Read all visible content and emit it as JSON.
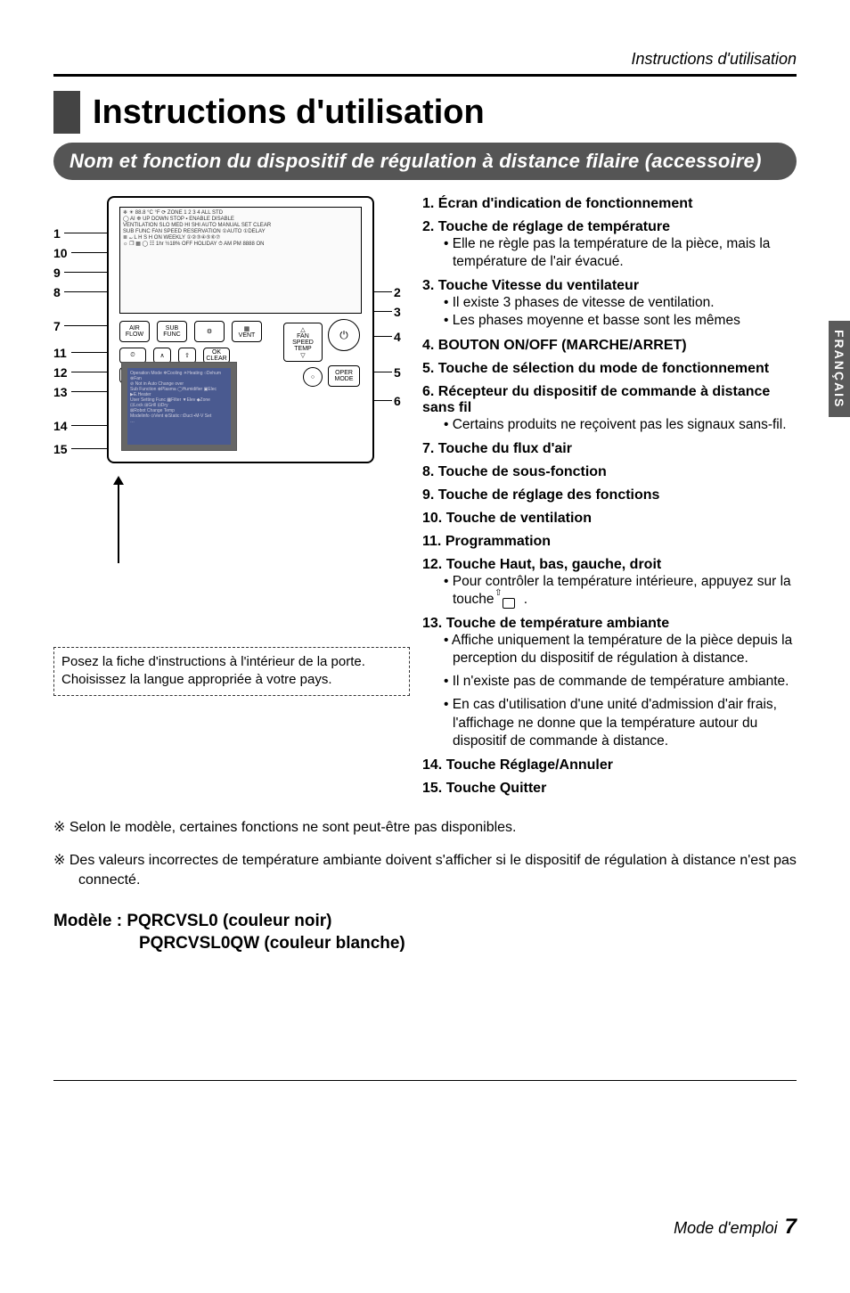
{
  "header": {
    "running": "Instructions d'utilisation"
  },
  "title": "Instructions d'utilisation",
  "pill": "Nom et fonction du dispositif de régulation à distance filaire (accessoire)",
  "diagram": {
    "callouts": [
      "1",
      "2",
      "3",
      "4",
      "5",
      "6",
      "7",
      "8",
      "9",
      "10",
      "11",
      "12",
      "13",
      "14",
      "15"
    ],
    "note_line1": "Posez la fiche d'instructions à l'intérieur de la porte.",
    "note_line2": "Choisissez la langue appropriée à votre pays."
  },
  "items": [
    {
      "num": "1.",
      "title": "Écran d'indication de fonctionnement"
    },
    {
      "num": "2.",
      "title": "Touche de réglage de température",
      "subs": [
        "Elle ne règle pas la température de la pièce, mais la température de l'air évacué."
      ]
    },
    {
      "num": "3.",
      "title": "Touche Vitesse du ventilateur",
      "subs": [
        "Il existe 3 phases de vitesse de ventilation.",
        "Les phases moyenne et basse sont les mêmes"
      ]
    },
    {
      "num": "4.",
      "title": "BOUTON ON/OFF (MARCHE/ARRET)"
    },
    {
      "num": "5.",
      "title": "Touche de sélection du mode de fonctionnement"
    },
    {
      "num": "6.",
      "title": "Récepteur du dispositif de commande à distance sans fil",
      "subs": [
        "Certains produits ne reçoivent pas les signaux sans-fil."
      ]
    },
    {
      "num": "7.",
      "title": "Touche du flux d'air"
    },
    {
      "num": "8.",
      "title": "Touche de sous-fonction"
    },
    {
      "num": "9.",
      "title": "Touche de réglage des fonctions"
    },
    {
      "num": "10.",
      "title": "Touche de ventilation"
    },
    {
      "num": "11.",
      "title": "Programmation"
    },
    {
      "num": "12.",
      "title": "Touche Haut, bas, gauche, droit",
      "subs_custom": {
        "line1": "Pour contrôler la température intérieure, appuyez sur la touche",
        "suffix": "."
      }
    },
    {
      "num": "13.",
      "title": "Touche de température ambiante",
      "subs": [
        "Affiche uniquement la température de la pièce depuis la perception du dispositif de régulation à distance.",
        "Il n'existe pas de commande de température ambiante.",
        "En cas d'utilisation d'une unité d'admission d'air frais, l'affichage ne donne que la température autour du dispositif de commande à distance."
      ]
    },
    {
      "num": "14.",
      "title": "Touche Réglage/Annuler"
    },
    {
      "num": "15.",
      "title": "Touche Quitter"
    }
  ],
  "side_tab": "FRANÇAIS",
  "footnotes": [
    "Selon le modèle, certaines fonctions ne sont peut-être pas disponibles.",
    "Des valeurs incorrectes de température ambiante doivent s'afficher si le dispositif de régulation à distance n'est pas connecté."
  ],
  "model": {
    "line1": "Modèle : PQRCVSL0 (couleur noir)",
    "line2": "PQRCVSL0QW (couleur blanche)"
  },
  "footer": {
    "text": "Mode d'emploi",
    "page": "7"
  }
}
